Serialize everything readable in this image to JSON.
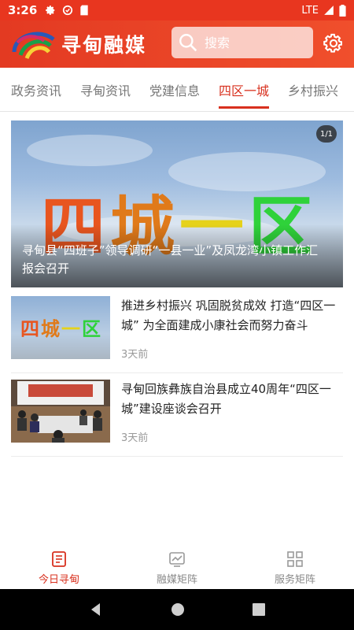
{
  "status_bar": {
    "time": "3:26",
    "network": "LTE"
  },
  "header": {
    "app_name": "寻甸融媒",
    "search_placeholder": "搜索",
    "brand_color": "#e8361f"
  },
  "tabs": [
    {
      "label": "政务资讯",
      "active": false
    },
    {
      "label": "寻甸资讯",
      "active": false
    },
    {
      "label": "党建信息",
      "active": false
    },
    {
      "label": "四区一城",
      "active": true
    },
    {
      "label": "乡村振兴",
      "active": false
    }
  ],
  "hero": {
    "image_text": [
      "四",
      "城",
      "一",
      "区"
    ],
    "caption": "寻甸县“四班子”领导调研“一县一业”及凤龙湾小镇工作汇报会召开",
    "counter": "1/1"
  },
  "news": [
    {
      "title": "推进乡村振兴 巩固脱贫成效 打造“四区一城” 为全面建成小康社会而努力奋斗",
      "time": "3天前",
      "thumb_text": [
        "四",
        "城",
        "一",
        "区"
      ]
    },
    {
      "title": "寻甸回族彝族自治县成立40周年“四区一城”建设座谈会召开",
      "time": "3天前"
    }
  ],
  "bottom_nav": [
    {
      "label": "今日寻甸",
      "icon": "news-icon",
      "active": true
    },
    {
      "label": "融媒矩阵",
      "icon": "matrix-icon",
      "active": false
    },
    {
      "label": "服务矩阵",
      "icon": "grid-icon",
      "active": false
    }
  ]
}
